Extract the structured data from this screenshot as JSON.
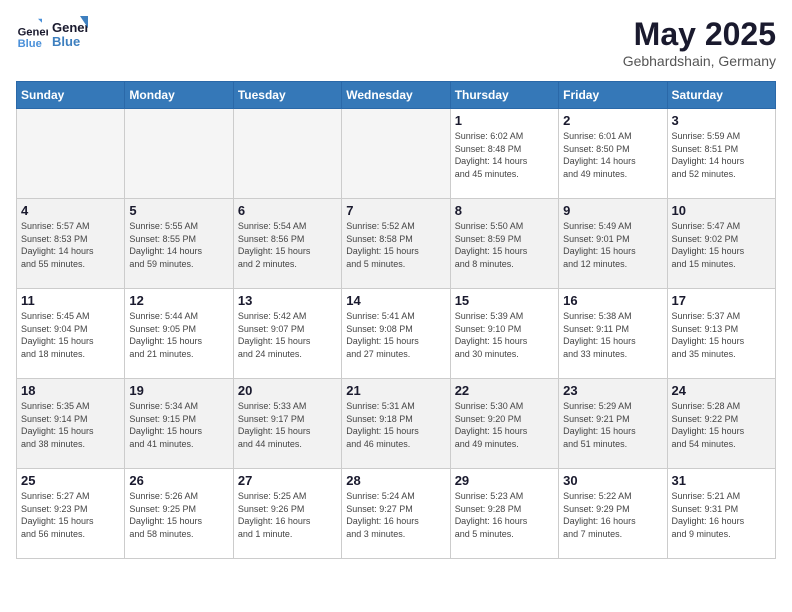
{
  "header": {
    "logo_line1": "General",
    "logo_line2": "Blue",
    "month": "May 2025",
    "location": "Gebhardshain, Germany"
  },
  "days_of_week": [
    "Sunday",
    "Monday",
    "Tuesday",
    "Wednesday",
    "Thursday",
    "Friday",
    "Saturday"
  ],
  "weeks": [
    {
      "row_class": "row-white",
      "days": [
        {
          "date": "",
          "info": ""
        },
        {
          "date": "",
          "info": ""
        },
        {
          "date": "",
          "info": ""
        },
        {
          "date": "",
          "info": ""
        },
        {
          "date": "1",
          "info": "Sunrise: 6:02 AM\nSunset: 8:48 PM\nDaylight: 14 hours\nand 45 minutes."
        },
        {
          "date": "2",
          "info": "Sunrise: 6:01 AM\nSunset: 8:50 PM\nDaylight: 14 hours\nand 49 minutes."
        },
        {
          "date": "3",
          "info": "Sunrise: 5:59 AM\nSunset: 8:51 PM\nDaylight: 14 hours\nand 52 minutes."
        }
      ]
    },
    {
      "row_class": "row-gray",
      "days": [
        {
          "date": "4",
          "info": "Sunrise: 5:57 AM\nSunset: 8:53 PM\nDaylight: 14 hours\nand 55 minutes."
        },
        {
          "date": "5",
          "info": "Sunrise: 5:55 AM\nSunset: 8:55 PM\nDaylight: 14 hours\nand 59 minutes."
        },
        {
          "date": "6",
          "info": "Sunrise: 5:54 AM\nSunset: 8:56 PM\nDaylight: 15 hours\nand 2 minutes."
        },
        {
          "date": "7",
          "info": "Sunrise: 5:52 AM\nSunset: 8:58 PM\nDaylight: 15 hours\nand 5 minutes."
        },
        {
          "date": "8",
          "info": "Sunrise: 5:50 AM\nSunset: 8:59 PM\nDaylight: 15 hours\nand 8 minutes."
        },
        {
          "date": "9",
          "info": "Sunrise: 5:49 AM\nSunset: 9:01 PM\nDaylight: 15 hours\nand 12 minutes."
        },
        {
          "date": "10",
          "info": "Sunrise: 5:47 AM\nSunset: 9:02 PM\nDaylight: 15 hours\nand 15 minutes."
        }
      ]
    },
    {
      "row_class": "row-white",
      "days": [
        {
          "date": "11",
          "info": "Sunrise: 5:45 AM\nSunset: 9:04 PM\nDaylight: 15 hours\nand 18 minutes."
        },
        {
          "date": "12",
          "info": "Sunrise: 5:44 AM\nSunset: 9:05 PM\nDaylight: 15 hours\nand 21 minutes."
        },
        {
          "date": "13",
          "info": "Sunrise: 5:42 AM\nSunset: 9:07 PM\nDaylight: 15 hours\nand 24 minutes."
        },
        {
          "date": "14",
          "info": "Sunrise: 5:41 AM\nSunset: 9:08 PM\nDaylight: 15 hours\nand 27 minutes."
        },
        {
          "date": "15",
          "info": "Sunrise: 5:39 AM\nSunset: 9:10 PM\nDaylight: 15 hours\nand 30 minutes."
        },
        {
          "date": "16",
          "info": "Sunrise: 5:38 AM\nSunset: 9:11 PM\nDaylight: 15 hours\nand 33 minutes."
        },
        {
          "date": "17",
          "info": "Sunrise: 5:37 AM\nSunset: 9:13 PM\nDaylight: 15 hours\nand 35 minutes."
        }
      ]
    },
    {
      "row_class": "row-gray",
      "days": [
        {
          "date": "18",
          "info": "Sunrise: 5:35 AM\nSunset: 9:14 PM\nDaylight: 15 hours\nand 38 minutes."
        },
        {
          "date": "19",
          "info": "Sunrise: 5:34 AM\nSunset: 9:15 PM\nDaylight: 15 hours\nand 41 minutes."
        },
        {
          "date": "20",
          "info": "Sunrise: 5:33 AM\nSunset: 9:17 PM\nDaylight: 15 hours\nand 44 minutes."
        },
        {
          "date": "21",
          "info": "Sunrise: 5:31 AM\nSunset: 9:18 PM\nDaylight: 15 hours\nand 46 minutes."
        },
        {
          "date": "22",
          "info": "Sunrise: 5:30 AM\nSunset: 9:20 PM\nDaylight: 15 hours\nand 49 minutes."
        },
        {
          "date": "23",
          "info": "Sunrise: 5:29 AM\nSunset: 9:21 PM\nDaylight: 15 hours\nand 51 minutes."
        },
        {
          "date": "24",
          "info": "Sunrise: 5:28 AM\nSunset: 9:22 PM\nDaylight: 15 hours\nand 54 minutes."
        }
      ]
    },
    {
      "row_class": "row-white",
      "days": [
        {
          "date": "25",
          "info": "Sunrise: 5:27 AM\nSunset: 9:23 PM\nDaylight: 15 hours\nand 56 minutes."
        },
        {
          "date": "26",
          "info": "Sunrise: 5:26 AM\nSunset: 9:25 PM\nDaylight: 15 hours\nand 58 minutes."
        },
        {
          "date": "27",
          "info": "Sunrise: 5:25 AM\nSunset: 9:26 PM\nDaylight: 16 hours\nand 1 minute."
        },
        {
          "date": "28",
          "info": "Sunrise: 5:24 AM\nSunset: 9:27 PM\nDaylight: 16 hours\nand 3 minutes."
        },
        {
          "date": "29",
          "info": "Sunrise: 5:23 AM\nSunset: 9:28 PM\nDaylight: 16 hours\nand 5 minutes."
        },
        {
          "date": "30",
          "info": "Sunrise: 5:22 AM\nSunset: 9:29 PM\nDaylight: 16 hours\nand 7 minutes."
        },
        {
          "date": "31",
          "info": "Sunrise: 5:21 AM\nSunset: 9:31 PM\nDaylight: 16 hours\nand 9 minutes."
        }
      ]
    }
  ]
}
